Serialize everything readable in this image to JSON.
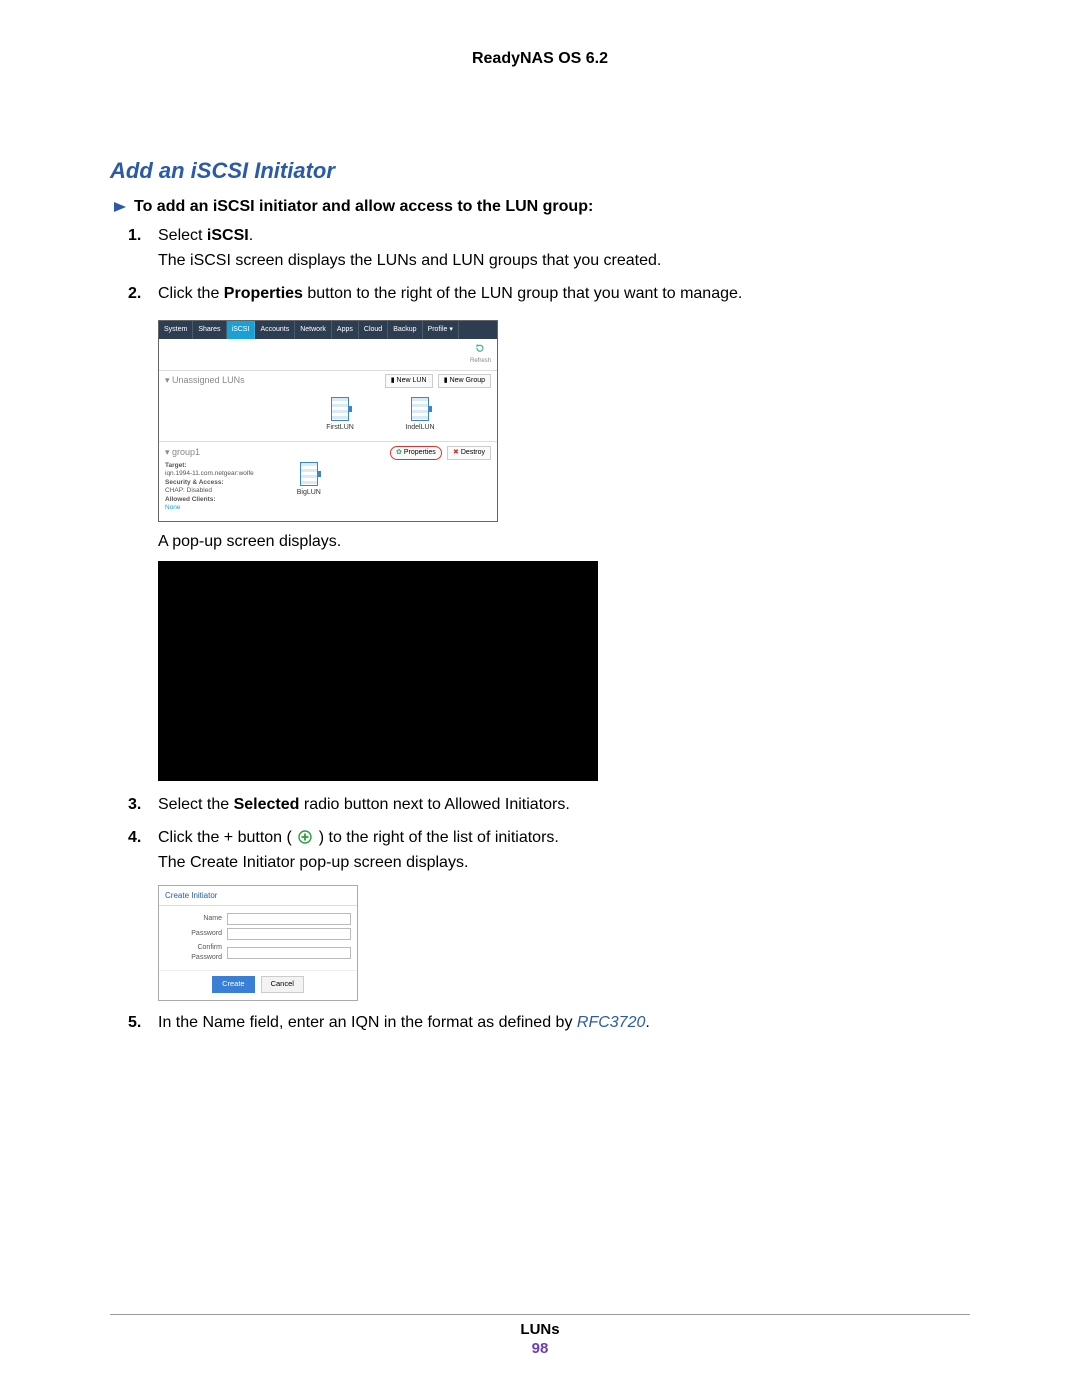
{
  "header": {
    "title": "ReadyNAS OS 6.2"
  },
  "heading": "Add an iSCSI Initiator",
  "intro": "To add an iSCSI initiator and allow access to the LUN group:",
  "steps": {
    "s1": {
      "num": "1.",
      "a": "Select ",
      "b": "iSCSI",
      "c": ".",
      "para": "The iSCSI screen displays the LUNs and LUN groups that you created."
    },
    "s2": {
      "num": "2.",
      "a": "Click the ",
      "b": "Properties",
      "c": " button to the right of the LUN group that you want to manage."
    },
    "popup_para": "A pop-up screen displays.",
    "s3": {
      "num": "3.",
      "a": "Select the ",
      "b": "Selected",
      "c": " radio button next to Allowed Initiators."
    },
    "s4": {
      "num": "4.",
      "a": "Click the + button ( ",
      "b": " ) to the right of the list of initiators.",
      "para": "The Create Initiator pop-up screen displays."
    },
    "s5": {
      "num": "5.",
      "a": "In the Name field, enter an IQN in the format as defined by ",
      "link": "RFC3720",
      "c": "."
    }
  },
  "shot1": {
    "tabs": [
      "System",
      "Shares",
      "iSCSI",
      "Accounts",
      "Network",
      "Apps",
      "Cloud",
      "Backup",
      "Profile ▾"
    ],
    "refresh": "Refresh",
    "unassigned_label": "Unassigned LUNs",
    "new_lun": "New LUN",
    "new_group": "New Group",
    "luns": [
      "FirstLUN",
      "IndelLUN"
    ],
    "group_name": "group1",
    "properties": "Properties",
    "destroy": "Destroy",
    "meta": {
      "target_label": "Target:",
      "target_val": "iqn.1994-11.com.netgear:wolfe",
      "sec_label": "Security & Access:",
      "sec_val": "CHAP: Disabled",
      "clients_label": "Allowed Clients:",
      "clients_val": "None"
    },
    "group_lun": "BigLUN"
  },
  "dialog": {
    "title": "Create Initiator",
    "name_label": "Name",
    "pwd_label": "Password",
    "confirm_label": "Confirm Password",
    "create": "Create",
    "cancel": "Cancel"
  },
  "footer": {
    "section": "LUNs",
    "page": "98"
  }
}
